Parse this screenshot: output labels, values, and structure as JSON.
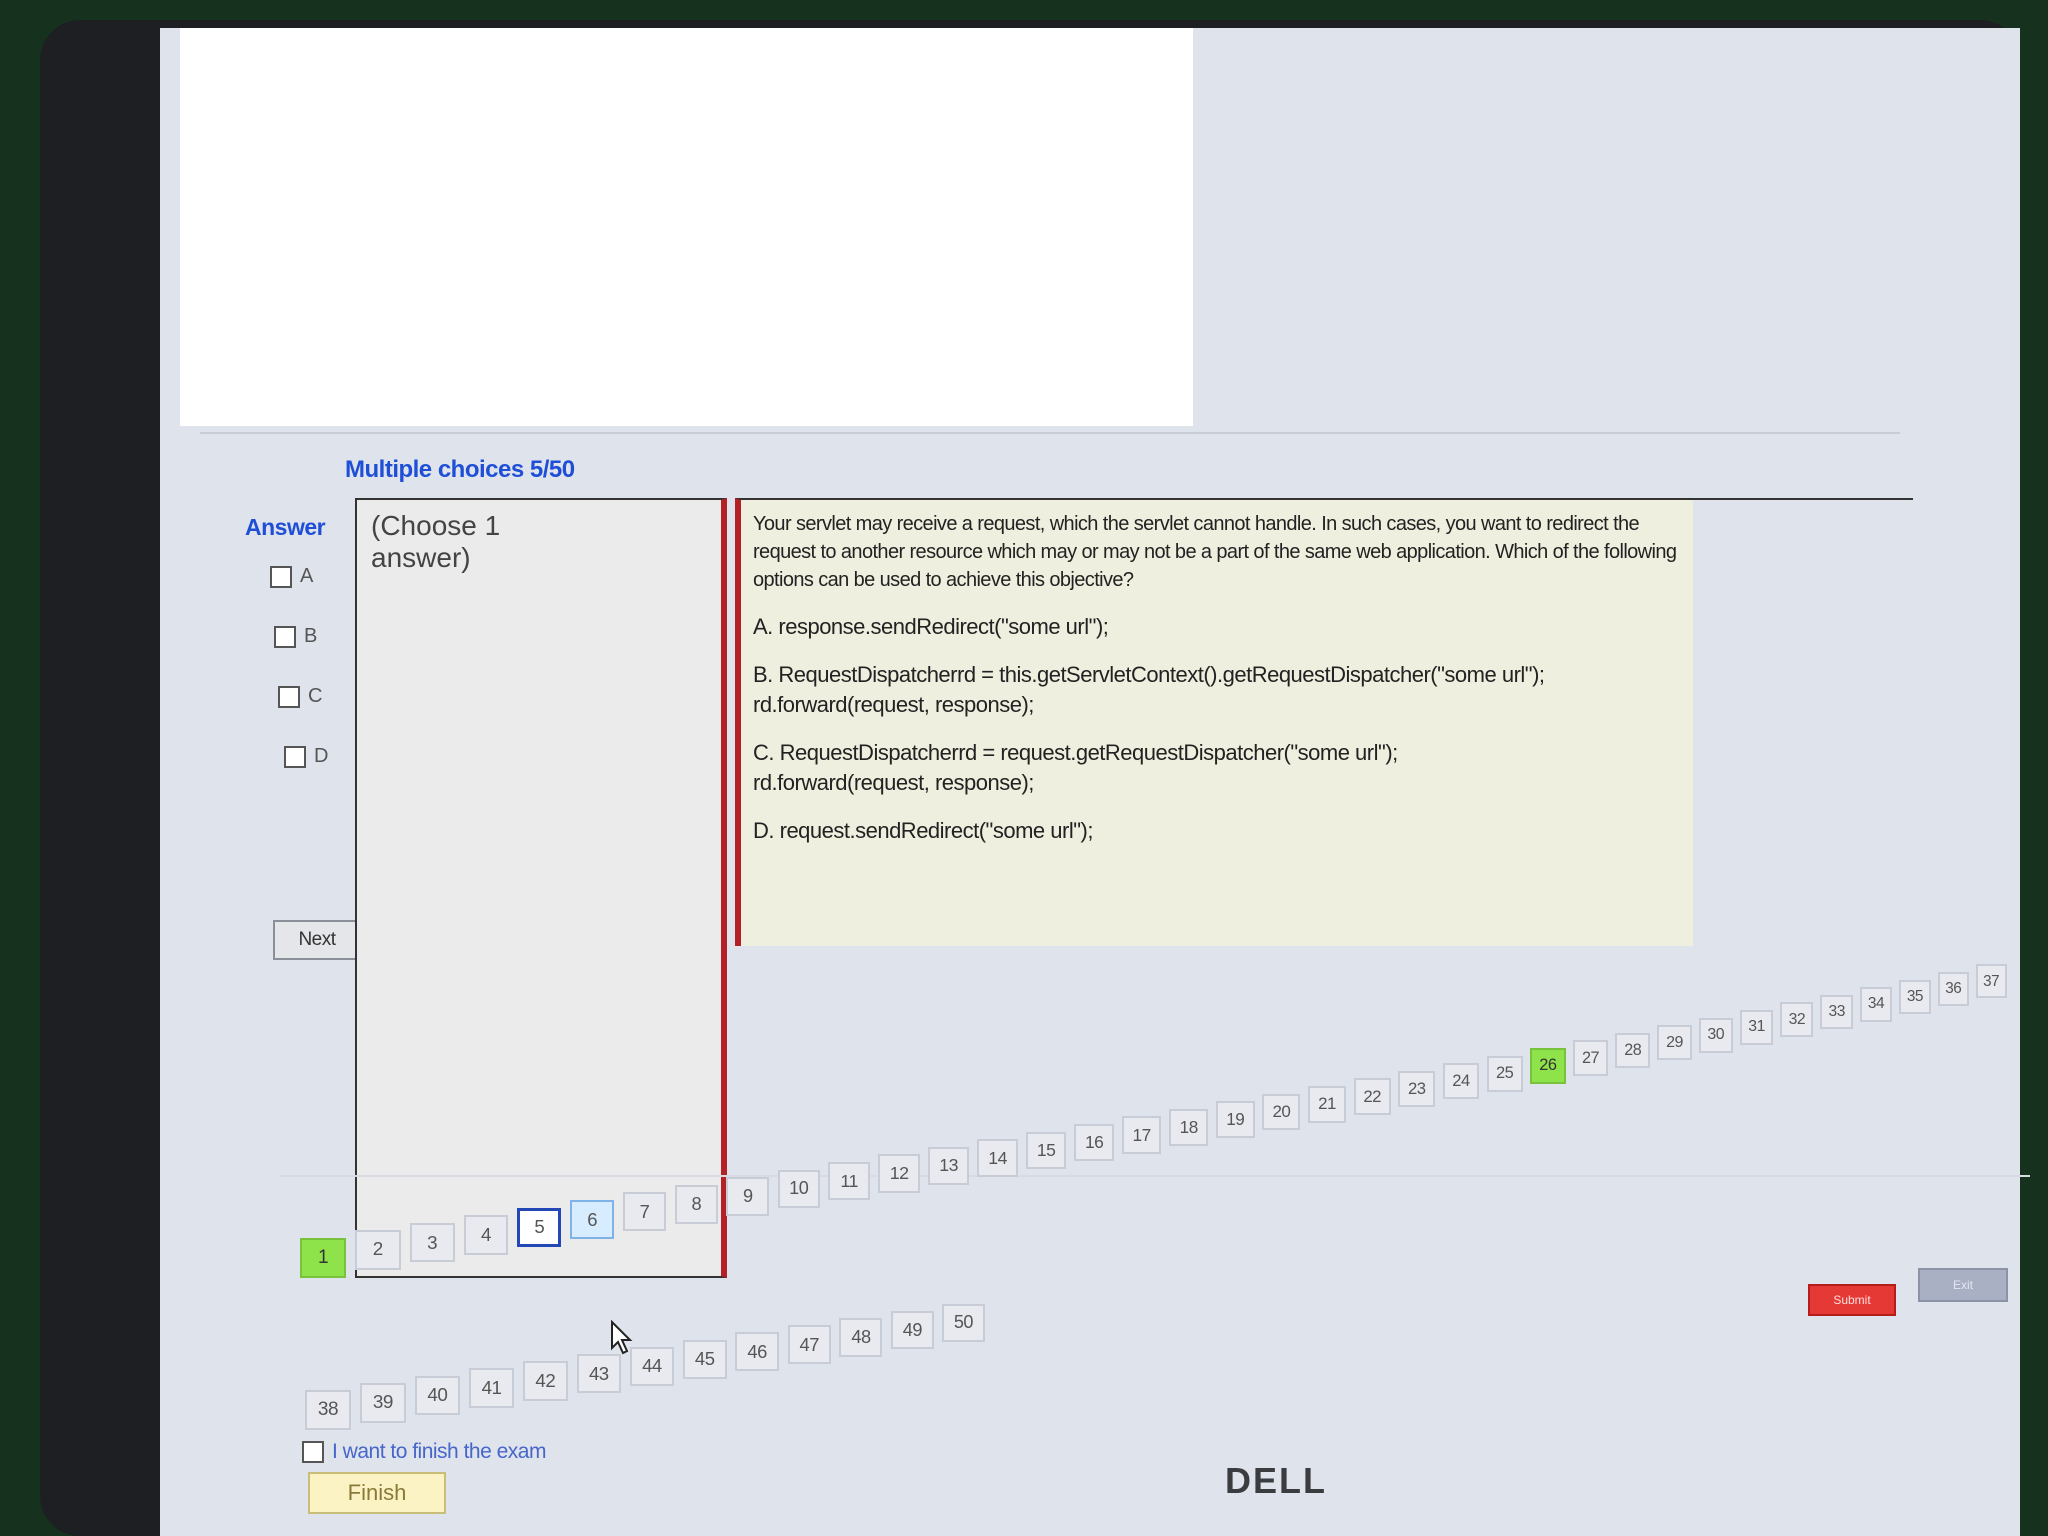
{
  "section_title": "Multiple choices 5/50",
  "answer": {
    "label": "Answer",
    "options": [
      "A",
      "B",
      "C",
      "D"
    ]
  },
  "next_label": "Next",
  "choose_hint": "(Choose 1 answer)",
  "question": {
    "stem": "Your servlet may receive a request, which the servlet cannot handle. In such cases, you want to redirect the request to another resource which may or may not be a part of the same web application. Which of the following options can be used to achieve this objective?",
    "options": [
      {
        "line1": "A. response.sendRedirect(\"some url\");",
        "line2": ""
      },
      {
        "line1": "B. RequestDispatcherrd = this.getServletContext().getRequestDispatcher(\"some url\");",
        "line2": "rd.forward(request, response);"
      },
      {
        "line1": "C. RequestDispatcherrd = request.getRequestDispatcher(\"some url\");",
        "line2": "rd.forward(request, response);"
      },
      {
        "line1": "D. request.sendRedirect(\"some url\");",
        "line2": ""
      }
    ]
  },
  "pager": {
    "row1": [
      "1",
      "2",
      "3",
      "4",
      "5",
      "6",
      "7",
      "8",
      "9",
      "10",
      "11",
      "12",
      "13",
      "14",
      "15",
      "16",
      "17",
      "18",
      "19",
      "20",
      "21",
      "22",
      "23",
      "24",
      "25",
      "26",
      "27",
      "28",
      "29",
      "30",
      "31",
      "32",
      "33",
      "34",
      "35",
      "36",
      "37"
    ],
    "row2": [
      "38",
      "39",
      "40",
      "41",
      "42",
      "43",
      "44",
      "45",
      "46",
      "47",
      "48",
      "49",
      "50"
    ],
    "answered": [
      "1",
      "26"
    ],
    "current": "5",
    "hover": "6"
  },
  "submit_label": "Submit",
  "exit_label": "Exit",
  "finish_check_label": "I want to finish the exam",
  "finish_label": "Finish",
  "brand": "DELL"
}
